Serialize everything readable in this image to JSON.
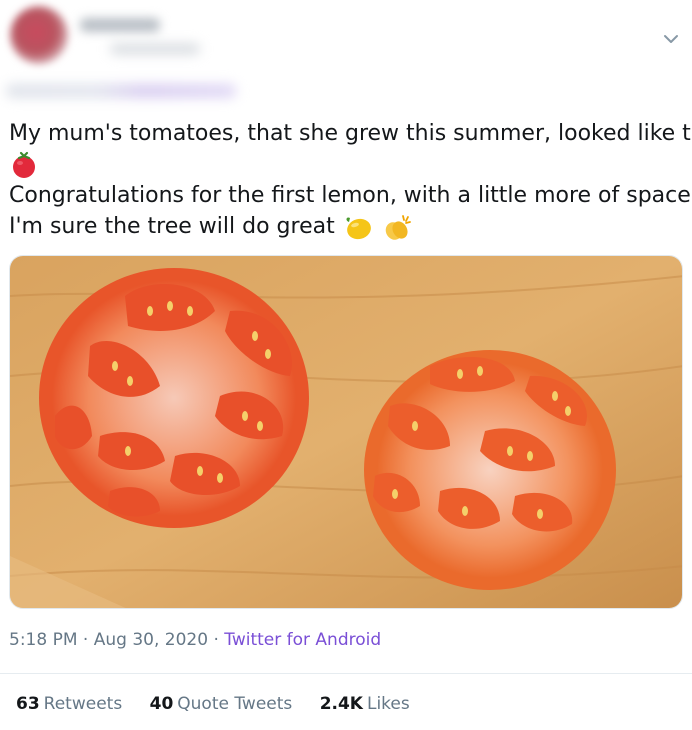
{
  "tweet": {
    "line1": "My mum's tomatoes, that she grew this summer, looked like this",
    "line2": "Congratulations for the first lemon, with a little more of space",
    "line3": "I'm sure the tree will do great",
    "emoji_line1": "tomato-emoji",
    "emoji_line3": [
      "lemon-emoji",
      "clapping-hands-emoji"
    ]
  },
  "meta": {
    "time": "5:18 PM",
    "sep1": "·",
    "date": "Aug 30, 2020",
    "sep2": "·",
    "source": "Twitter for Android"
  },
  "stats": {
    "retweets_count": "63",
    "retweets_label": "Retweets",
    "quotes_count": "40",
    "quotes_label": "Quote Tweets",
    "likes_count": "2.4K",
    "likes_label": "Likes"
  },
  "colors": {
    "text": "#14171a",
    "muted": "#657786",
    "source_link": "#7a4fd6",
    "divider": "#e6ecf0"
  },
  "icons": {
    "more": "chevron-down-icon"
  }
}
